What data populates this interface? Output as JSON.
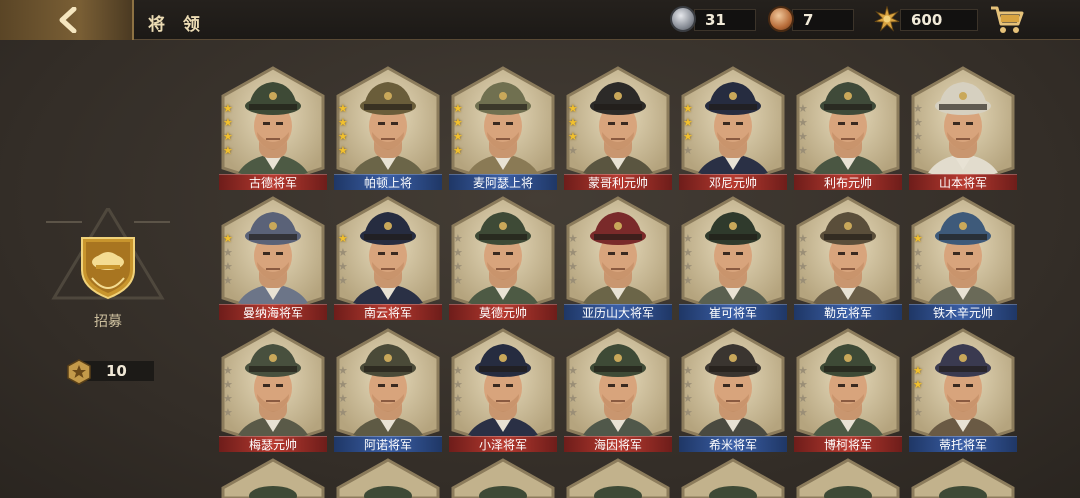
{
  "header": {
    "title": "将 领",
    "silver_medals": "31",
    "bronze_medals": "7",
    "gold_stars": "600"
  },
  "recruit": {
    "label": "招募",
    "cost": "10"
  },
  "colors": {
    "red_rank": "#b73a30",
    "blue_rank": "#3b5fa6",
    "star_gold": "#f2c12e",
    "card_frame": "#c9b892",
    "card_bg": "#d8c9a6"
  },
  "generals": [
    {
      "name": "古德将军",
      "stars": 4,
      "banner": "red",
      "uniform": "#4d5a44",
      "cap": "#3e4a36"
    },
    {
      "name": "帕顿上将",
      "stars": 4,
      "banner": "blue",
      "uniform": "#6b6548",
      "cap": "#6a5d3a"
    },
    {
      "name": "麦阿瑟上将",
      "stars": 4,
      "banner": "blue",
      "uniform": "#8a7a55",
      "cap": "#707050"
    },
    {
      "name": "蒙哥利元帅",
      "stars": 3,
      "banner": "red",
      "uniform": "#5a5540",
      "cap": "#2c2a28"
    },
    {
      "name": "邓尼元帅",
      "stars": 3,
      "banner": "red",
      "uniform": "#2a3045",
      "cap": "#262c40"
    },
    {
      "name": "利布元帅",
      "stars": 0,
      "banner": "red",
      "uniform": "#4a5642",
      "cap": "#3f4a39"
    },
    {
      "name": "山本将军",
      "stars": 0,
      "banner": "red",
      "uniform": "#e2dccd",
      "cap": "#d6d0c0"
    },
    {
      "name": "曼纳海将军",
      "stars": 1,
      "banner": "red",
      "uniform": "#6c7588",
      "cap": "#5a6278"
    },
    {
      "name": "南云将军",
      "stars": 1,
      "banner": "red",
      "uniform": "#2a3045",
      "cap": "#262c40"
    },
    {
      "name": "莫德元帅",
      "stars": 0,
      "banner": "red",
      "uniform": "#4d5a44",
      "cap": "#3e4a36"
    },
    {
      "name": "亚历山大将军",
      "stars": 0,
      "banner": "blue",
      "uniform": "#6b6548",
      "cap": "#7a2a2a"
    },
    {
      "name": "崔可将军",
      "stars": 0,
      "banner": "blue",
      "uniform": "#5a6050",
      "cap": "#2f3a2c"
    },
    {
      "name": "勒克将军",
      "stars": 0,
      "banner": "blue",
      "uniform": "#6a5e48",
      "cap": "#5a4e3a"
    },
    {
      "name": "铁木辛元帅",
      "stars": 1,
      "banner": "blue",
      "uniform": "#6a6a58",
      "cap": "#3e5a7a"
    },
    {
      "name": "梅瑟元帅",
      "stars": 0,
      "banner": "red",
      "uniform": "#5a5a48",
      "cap": "#48503e"
    },
    {
      "name": "阿诺将军",
      "stars": 0,
      "banner": "blue",
      "uniform": "#5e5a44",
      "cap": "#4a4a38"
    },
    {
      "name": "小泽将军",
      "stars": 0,
      "banner": "red",
      "uniform": "#2a3045",
      "cap": "#262c40"
    },
    {
      "name": "海因将军",
      "stars": 0,
      "banner": "red",
      "uniform": "#50584a",
      "cap": "#3e4a36"
    },
    {
      "name": "希米将军",
      "stars": 0,
      "banner": "blue",
      "uniform": "#4a4a40",
      "cap": "#3a3530"
    },
    {
      "name": "博柯将军",
      "stars": 0,
      "banner": "red",
      "uniform": "#4d5a44",
      "cap": "#3e4a36"
    },
    {
      "name": "蒂托将军",
      "stars": 2,
      "banner": "blue",
      "uniform": "#6a5a44",
      "cap": "#3a3a50"
    }
  ]
}
